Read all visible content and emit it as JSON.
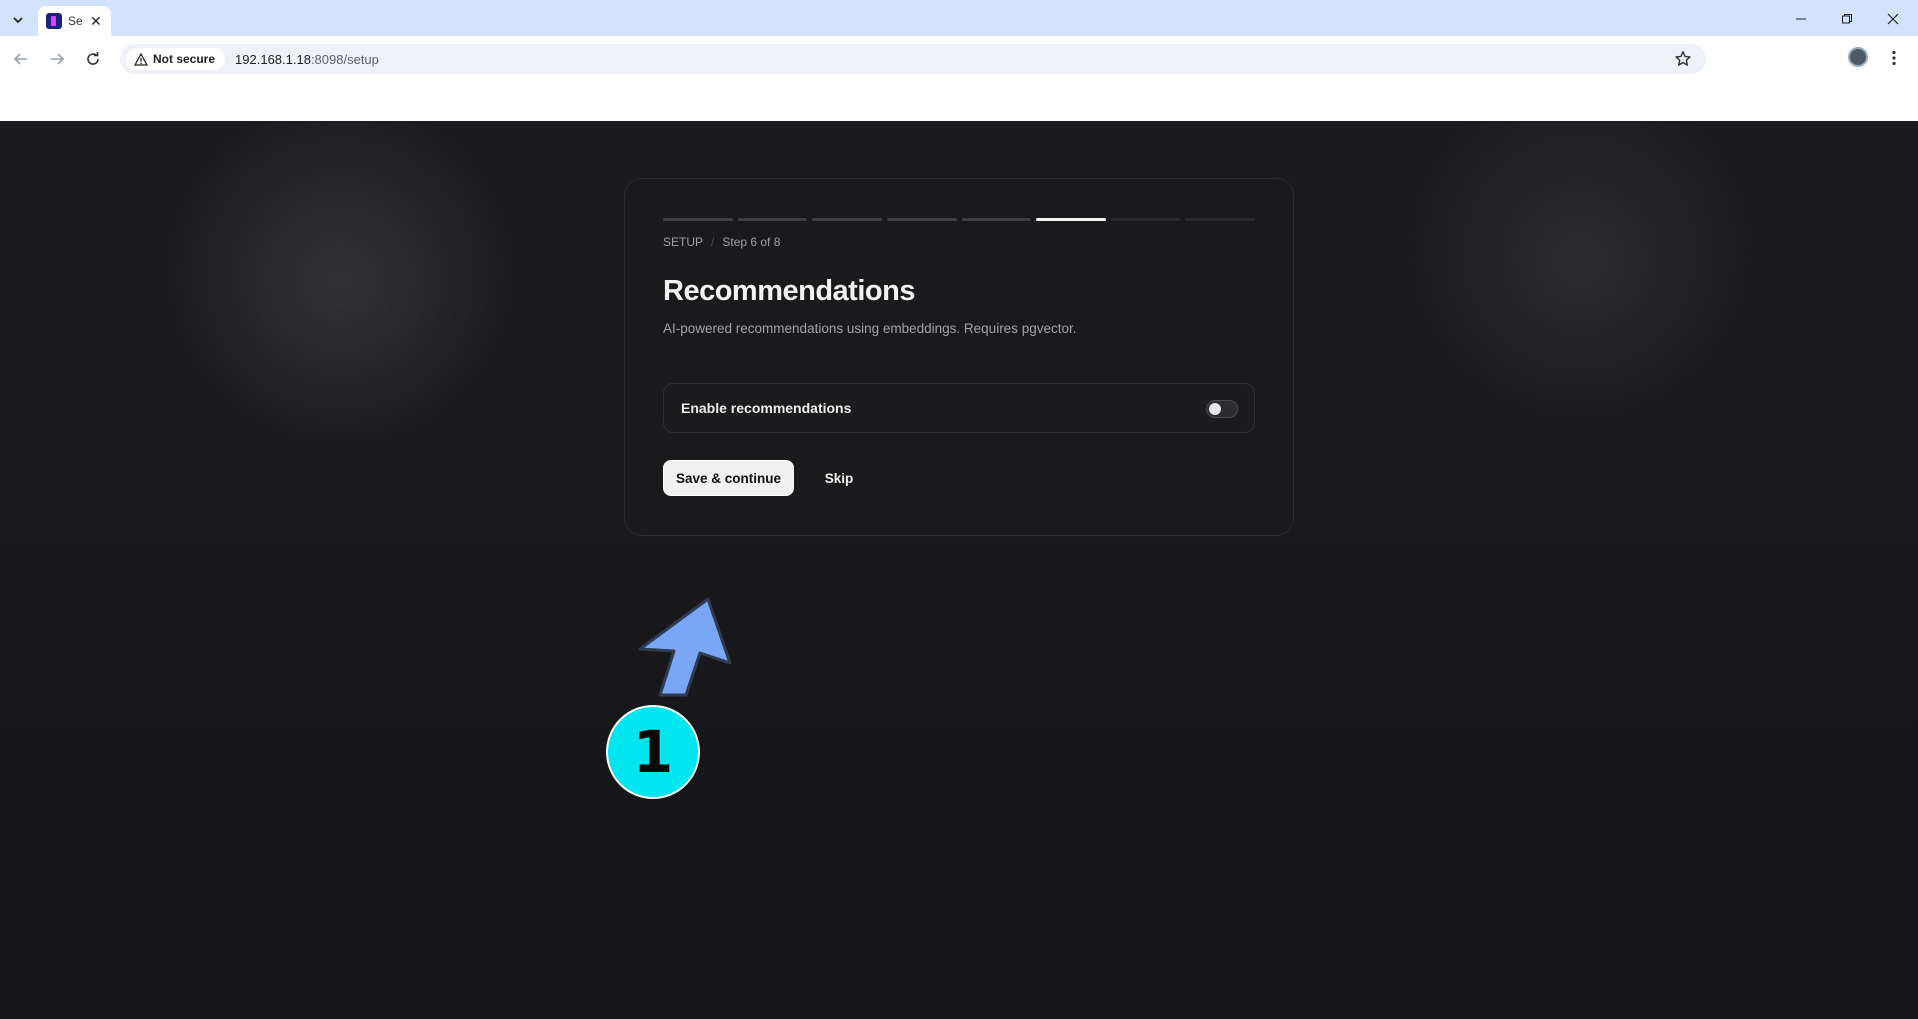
{
  "browser": {
    "tab_title": "Se",
    "security_label": "Not secure",
    "url_host": "192.168.1.18",
    "url_rest": ":8098/setup"
  },
  "setup": {
    "breadcrumb_section": "SETUP",
    "breadcrumb_step": "Step 6 of 8",
    "progress": {
      "current_step": 6,
      "total_steps": 8
    },
    "title": "Recommendations",
    "description": "AI-powered recommendations using embeddings. Requires pgvector.",
    "toggle_label": "Enable recommendations",
    "toggle_on": false,
    "save_label": "Save & continue",
    "skip_label": "Skip"
  },
  "annotation": {
    "step_number": "1",
    "color": "#00e5ee",
    "arrow_color": "#7aa7f5"
  }
}
